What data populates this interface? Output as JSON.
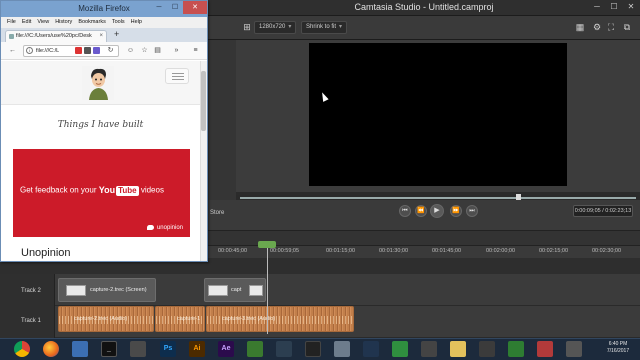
{
  "camtasia": {
    "title": "Camtasia Studio - Untitled.camproj",
    "toolbar": {
      "dimensions": "1280x720",
      "zoom": "Shrink to fit"
    },
    "player": {
      "time_readout": "0:00:09;05 / 0:02:23;13",
      "store_label": "Store"
    },
    "timeline": {
      "ticks": [
        "00:00:45;00",
        "00:00:59;05",
        "00:01:15;00",
        "00:01:30;00",
        "00:01:45;00",
        "00:02:00;00",
        "00:02:15;00",
        "00:02:30;00"
      ],
      "tracks": [
        {
          "label": "Track 2",
          "clips": [
            {
              "label": "capture-2.trec (Screen)"
            },
            {
              "label": "capt"
            }
          ]
        },
        {
          "label": "Track 1",
          "clips": [
            {
              "label": "capture-2.trec (Audio)"
            },
            {
              "label": "capture-1"
            },
            {
              "label": "capture-3.trec (Audio)"
            }
          ]
        }
      ]
    }
  },
  "firefox": {
    "title": "Mozilla Firefox",
    "menu": [
      "File",
      "Edit",
      "View",
      "History",
      "Bookmarks",
      "Tools",
      "Help"
    ],
    "tab_title": "file:///C:/Users/use%20pc/Desk",
    "url": "file:///C:/L",
    "page": {
      "heading": "Things I have built",
      "banner": {
        "pre_text": "Get feedback on your",
        "logo_you": "You",
        "logo_tube": "Tube",
        "post_text": "videos",
        "brand": "unopinion"
      },
      "project_title": "Unopinion"
    }
  },
  "taskbar": {
    "clock_time": "6:40 PM",
    "clock_date": "7/16/2017",
    "apps": [
      {
        "name": "chrome",
        "label": "",
        "color": "#d9412f"
      },
      {
        "name": "firefox",
        "label": "",
        "color": "#e8651c"
      },
      {
        "name": "explorer",
        "label": "",
        "color": "#3c6fb3"
      },
      {
        "name": "photoshop",
        "label": "Ps",
        "color": "#0d2d4d"
      },
      {
        "name": "illustrator",
        "label": "Ai",
        "color": "#4c2a00"
      },
      {
        "name": "after-effects",
        "label": "Ae",
        "color": "#2b0b4c"
      },
      {
        "name": "camtasia",
        "label": "",
        "color": "#3a7a2f"
      }
    ]
  },
  "colors": {
    "yt_red": "#cc1b29",
    "audio_clip": "#c27f4b",
    "playhead": "#6aa84f"
  }
}
